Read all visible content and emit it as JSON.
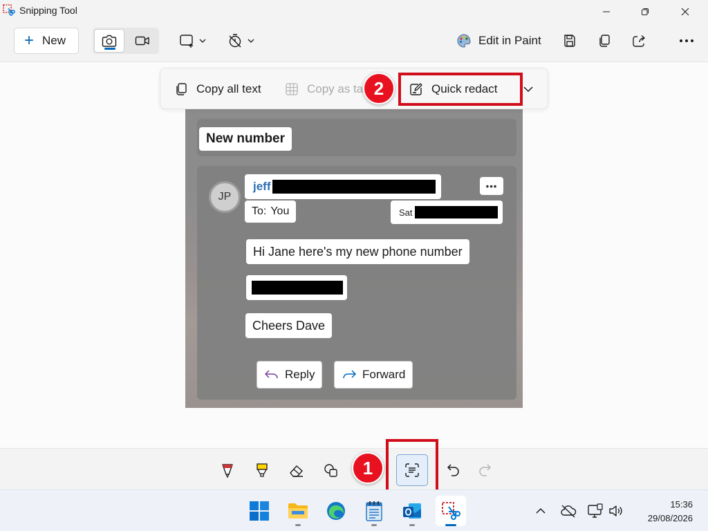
{
  "window": {
    "title": "Snipping Tool"
  },
  "toolbar": {
    "new_label": "New",
    "edit_in_paint_label": "Edit in Paint"
  },
  "text_actions": {
    "copy_all_text": "Copy all text",
    "copy_as_table": "Copy as ta",
    "quick_redact": "Quick redact"
  },
  "callouts": {
    "one": "1",
    "two": "2"
  },
  "snip": {
    "header": "New number",
    "avatar_initials": "JP",
    "sender": "jeff",
    "to_label": "To:",
    "to_value": "You",
    "date_prefix": "Sat",
    "more": "•••",
    "message_line1": "Hi Jane here's my new phone number",
    "message_sign": "Cheers Dave",
    "reply_label": "Reply",
    "forward_label": "Forward"
  },
  "taskbar": {
    "time": "15:36",
    "date": "29/08/2026"
  },
  "colors": {
    "accent": "#0067c0",
    "highlight_red": "#d00e1b",
    "badge_red": "#e8111f"
  }
}
